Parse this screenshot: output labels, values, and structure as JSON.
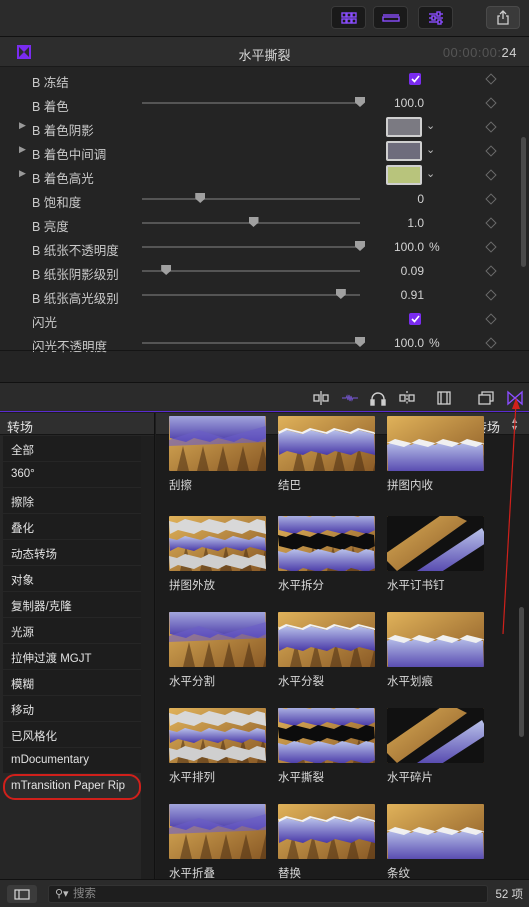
{
  "toolbar": {
    "buttons": [
      "browser-view-icon",
      "timeline-view-icon",
      "inspector-view-icon",
      "share-icon"
    ]
  },
  "inspector": {
    "title": "水平撕裂",
    "timecode_dim": "00:00:00:",
    "timecode_bright": "24",
    "accent_color": "#7a2cf0",
    "params": [
      {
        "label": "B 冻结",
        "type": "checkbox",
        "checked": true
      },
      {
        "label": "B 着色",
        "type": "slider",
        "value": "100.0",
        "fraction": 1.0
      },
      {
        "label": "B 着色阴影",
        "type": "color",
        "color": "#7b7a82"
      },
      {
        "label": "B 着色中间调",
        "type": "color",
        "color": "#6e6c7c"
      },
      {
        "label": "B 着色高光",
        "type": "color",
        "color": "#b8c47c"
      },
      {
        "label": "B 饱和度",
        "type": "slider",
        "value": "0",
        "fraction": 0.25
      },
      {
        "label": "B 亮度",
        "type": "slider",
        "value": "1.0",
        "fraction": 0.5
      },
      {
        "label": "B 纸张不透明度",
        "type": "slider",
        "value": "100.0",
        "unit": "%",
        "fraction": 1.0
      },
      {
        "label": "B 纸张阴影级别",
        "type": "slider",
        "value": "0.09",
        "fraction": 0.09
      },
      {
        "label": "B 纸张高光级别",
        "type": "slider",
        "value": "0.91",
        "fraction": 0.91
      },
      {
        "label": "闪光",
        "type": "checkbox",
        "checked": true
      },
      {
        "label": "闪光不透明度",
        "type": "slider",
        "value": "100.0",
        "unit": "%",
        "fraction": 1.0
      }
    ]
  },
  "browser_toolbar": {
    "icons": [
      "trim-icon",
      "audio-wave-icon",
      "headphones-icon",
      "snapping-icon",
      "filmstrip-icon",
      "effects-browser-icon",
      "transitions-icon"
    ]
  },
  "sidebar": {
    "header": "转场",
    "items": [
      "全部",
      "360°",
      "擦除",
      "叠化",
      "动态转场",
      "对象",
      "复制器/克隆",
      "光源",
      "拉伸过渡 MGJT",
      "模糊",
      "移动",
      "已风格化",
      "mDocumentary",
      "mTransition Paper Rip"
    ],
    "selected_index": 13
  },
  "content": {
    "header": "已安装的转场",
    "rows": [
      [
        "刮擦",
        "结巴",
        "拼图内收"
      ],
      [
        "拼图外放",
        "水平拆分",
        "水平订书钉"
      ],
      [
        "水平分割",
        "水平分裂",
        "水平划痕"
      ],
      [
        "水平排列",
        "水平撕裂",
        "水平碎片"
      ],
      [
        "水平折叠",
        "替换",
        "条纹"
      ]
    ]
  },
  "footer": {
    "search_placeholder": "搜索",
    "count": "52 项"
  }
}
